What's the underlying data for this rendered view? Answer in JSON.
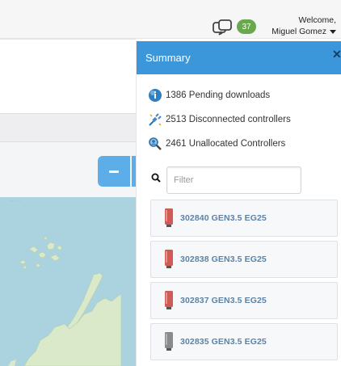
{
  "header": {
    "badge_count": "37",
    "welcome_label": "Welcome,",
    "user_name": "Miguel Gomez"
  },
  "summary": {
    "title": "Summary",
    "close_label": "✕",
    "stats": [
      {
        "icon": "info-globe-icon",
        "text": "1386 Pending downloads"
      },
      {
        "icon": "disconnected-plug-icon",
        "text": "2513 Disconnected controllers"
      },
      {
        "icon": "search-person-icon",
        "text": "2461 Unallocated Controllers"
      }
    ],
    "filter": {
      "placeholder": "Filter",
      "value": ""
    },
    "controllers": [
      {
        "label": "302840 GEN3.5 EG25",
        "status_color": "#d25a55"
      },
      {
        "label": "302838 GEN3.5 EG25",
        "status_color": "#d25a55"
      },
      {
        "label": "302837 GEN3.5 EG25",
        "status_color": "#d25a55"
      },
      {
        "label": "302835 GEN3.5 EG25",
        "status_color": "#8a8a8a"
      }
    ]
  },
  "colors": {
    "panel_header": "#3c97da",
    "badge": "#6aa84f",
    "map_water": "#aad3df",
    "map_land": "#d9e9c9"
  }
}
